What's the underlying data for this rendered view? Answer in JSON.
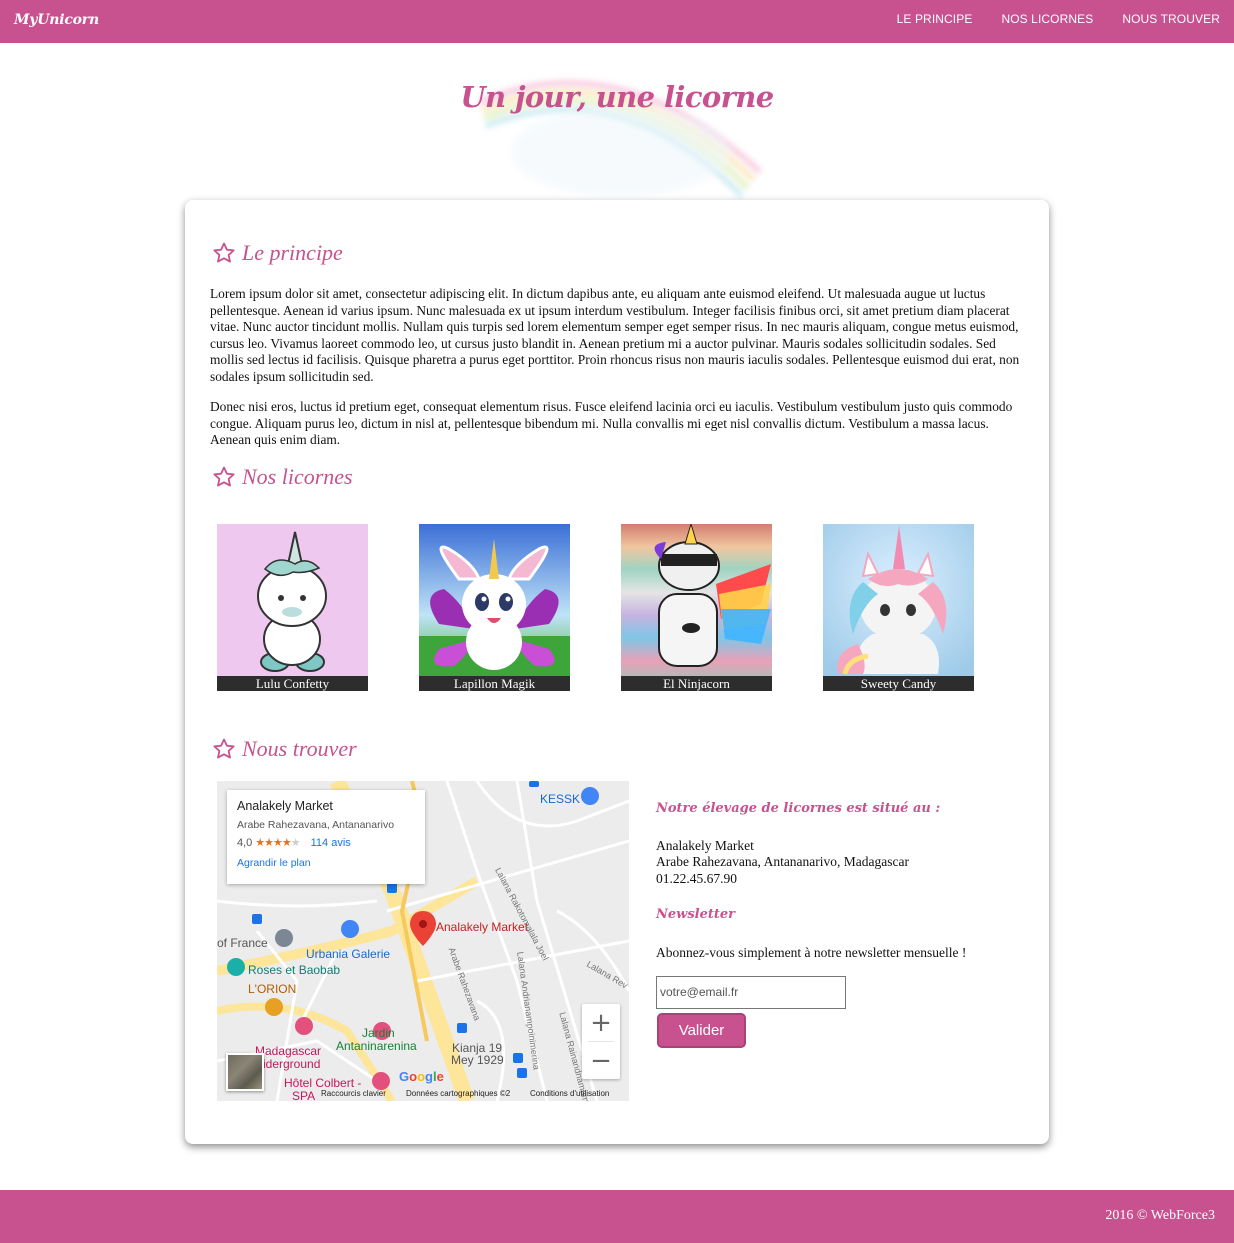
{
  "topbar": {
    "brand": "MyUnicorn",
    "nav": [
      "LE PRINCIPE",
      "NOS LICORNES",
      "NOUS TROUVER"
    ]
  },
  "hero": {
    "title": "Un jour, une licorne"
  },
  "sections": {
    "principe": {
      "title": "Le principe",
      "p1": "Lorem ipsum dolor sit amet, consectetur adipiscing elit. In dictum dapibus ante, eu aliquam ante euismod eleifend. Ut malesuada augue ut luctus pellentesque. Aenean id varius ipsum. Nunc malesuada ex ut ipsum interdum vestibulum. Integer facilisis finibus orci, sit amet pretium diam placerat vitae. Nunc auctor tincidunt mollis. Nullam quis turpis sed lorem elementum semper eget semper risus. In nec mauris aliquam, congue metus euismod, cursus leo. Vivamus laoreet commodo leo, ut cursus justo blandit in. Aenean pretium mi a auctor pulvinar. Mauris sodales sollicitudin sodales. Sed mollis sed lectus id facilisis. Quisque pharetra a purus eget porttitor. Proin rhoncus risus non mauris iaculis sodales. Pellentesque euismod dui erat, non sodales ipsum sollicitudin sed.",
      "p2": "Donec nisi eros, luctus id pretium eget, consequat elementum risus. Fusce eleifend lacinia orci eu iaculis. Vestibulum vestibulum justo quis commodo congue. Aliquam purus leo, dictum in nisl at, pellentesque bibendum mi. Nulla convallis mi eget nisl convallis dictum. Vestibulum a massa lacus. Aenean quis enim diam."
    },
    "licornes": {
      "title": "Nos licornes",
      "items": [
        "Lulu Confetty",
        "Lapillon Magik",
        "El Ninjacorn",
        "Sweety Candy"
      ]
    },
    "trouver": {
      "title": "Nous trouver",
      "location_heading": "Notre élevage de licornes est situé au :",
      "address_name": "Analakely Market",
      "address_line": "Arabe Rahezavana, Antananarivo, Madagascar",
      "phone": "01.22.45.67.90",
      "newsletter_heading": "Newsletter",
      "newsletter_text": "Abonnez-vous simplement à notre newsletter mensuelle !",
      "email_placeholder": "votre@email.fr",
      "submit_label": "Valider"
    }
  },
  "map": {
    "card_title": "Analakely Market",
    "card_address": "Arabe Rahezavana, Antananarivo",
    "rating": "4,0",
    "rating_value": 4.0,
    "reviews": "114 avis",
    "enlarge": "Agrandir le plan",
    "pin_label": "Analakely Market",
    "places": [
      "KESSK",
      "Urbania Galerie",
      "of France",
      "Roses et Baobab",
      "L'ORION",
      "Jardin",
      "Antaninarenina",
      "Madagascar",
      "iderground",
      "Hôtel Colbert -",
      "SPA",
      "Kianja 19",
      "Mey 1929"
    ],
    "streets": [
      "Lalana Rakotomalala Joel",
      "Arabe Rahezavana",
      "Lalana Andrianampoinimerina",
      "Lalana Rev",
      "Lalana Rainandriamampandry"
    ],
    "footer": [
      "Raccourcis clavier",
      "Données cartographiques ©2",
      "Conditions d'utilisation"
    ],
    "google": "Google"
  },
  "footer": {
    "copyright": "2016 © WebForce3"
  },
  "colors": {
    "brand": "#c7528f",
    "caption_bg": "#2d2d2d"
  }
}
